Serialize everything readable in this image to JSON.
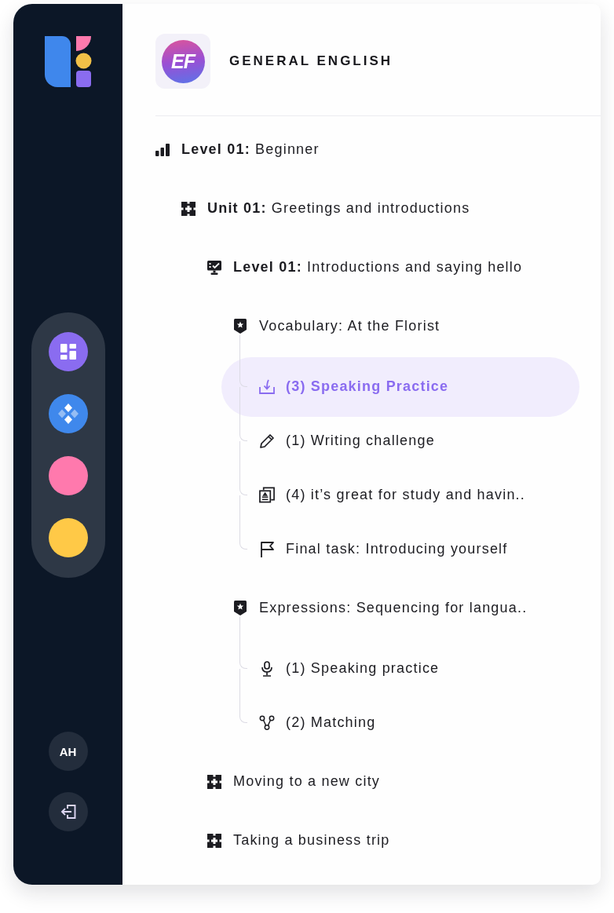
{
  "sidebar": {
    "nav_items": [
      {
        "kind": "dashboard",
        "color": "#8a6cf0"
      },
      {
        "kind": "components",
        "color": "#3f88ec"
      },
      {
        "kind": "plain",
        "color": "#ff79ad"
      },
      {
        "kind": "plain",
        "color": "#ffc947"
      }
    ],
    "avatar": {
      "initials": "AH"
    }
  },
  "course": {
    "logo_text": "EF",
    "title": "GENERAL ENGLISH",
    "tree": [
      {
        "kind": "level",
        "label": "**Level 01:** Beginner",
        "selected": false,
        "children": [
          {
            "kind": "unit",
            "label": "**Unit 01:** Greetings and introductions",
            "selected": false,
            "children": [
              {
                "kind": "lesson",
                "label": "**Level 01:** Introductions and saying hello",
                "selected": false,
                "children": [
                  {
                    "kind": "topic",
                    "label": "Vocabulary: At the Florist",
                    "selected": false,
                    "children": [
                      {
                        "kind": "submission",
                        "label": "(3) Speaking Practice",
                        "selected": true
                      },
                      {
                        "kind": "writing",
                        "label": "(1) Writing challenge",
                        "selected": false
                      },
                      {
                        "kind": "reading",
                        "label": "(4) it’s great for study and havin..",
                        "selected": false
                      },
                      {
                        "kind": "task",
                        "label": "Final task: Introducing yourself",
                        "selected": false
                      }
                    ]
                  },
                  {
                    "kind": "topic",
                    "label": "Expressions: Sequencing for langua..",
                    "selected": false,
                    "children": [
                      {
                        "kind": "speaking",
                        "label": "(1) Speaking practice",
                        "selected": false
                      },
                      {
                        "kind": "matching",
                        "label": "(2) Matching",
                        "selected": false
                      }
                    ]
                  }
                ]
              },
              {
                "kind": "unit",
                "label": "Moving to a new city",
                "selected": false
              },
              {
                "kind": "unit",
                "label": "Taking a business trip",
                "selected": false
              }
            ]
          }
        ]
      }
    ]
  }
}
